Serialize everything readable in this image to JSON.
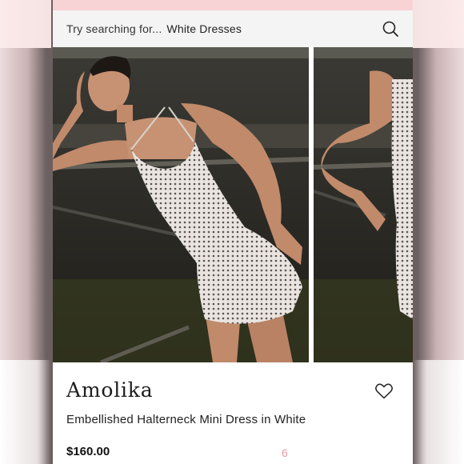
{
  "search": {
    "prompt": "Try searching for...",
    "query": "White Dresses"
  },
  "gallery": {
    "images": [
      {
        "alt": "Model wearing embellished white halterneck mini dress, front view"
      },
      {
        "alt": "Model wearing embellished white halterneck mini dress, side view"
      }
    ]
  },
  "product": {
    "brand": "Amolika",
    "title": "Embellished Halterneck Mini Dress in White",
    "price": "$160.00",
    "likes": "6"
  },
  "colors": {
    "promo_strip": "#f7d3d6",
    "search_bg": "#f4f4f4",
    "likes_text": "#e79aa6"
  },
  "icons": [
    "search-icon",
    "heart-icon"
  ]
}
